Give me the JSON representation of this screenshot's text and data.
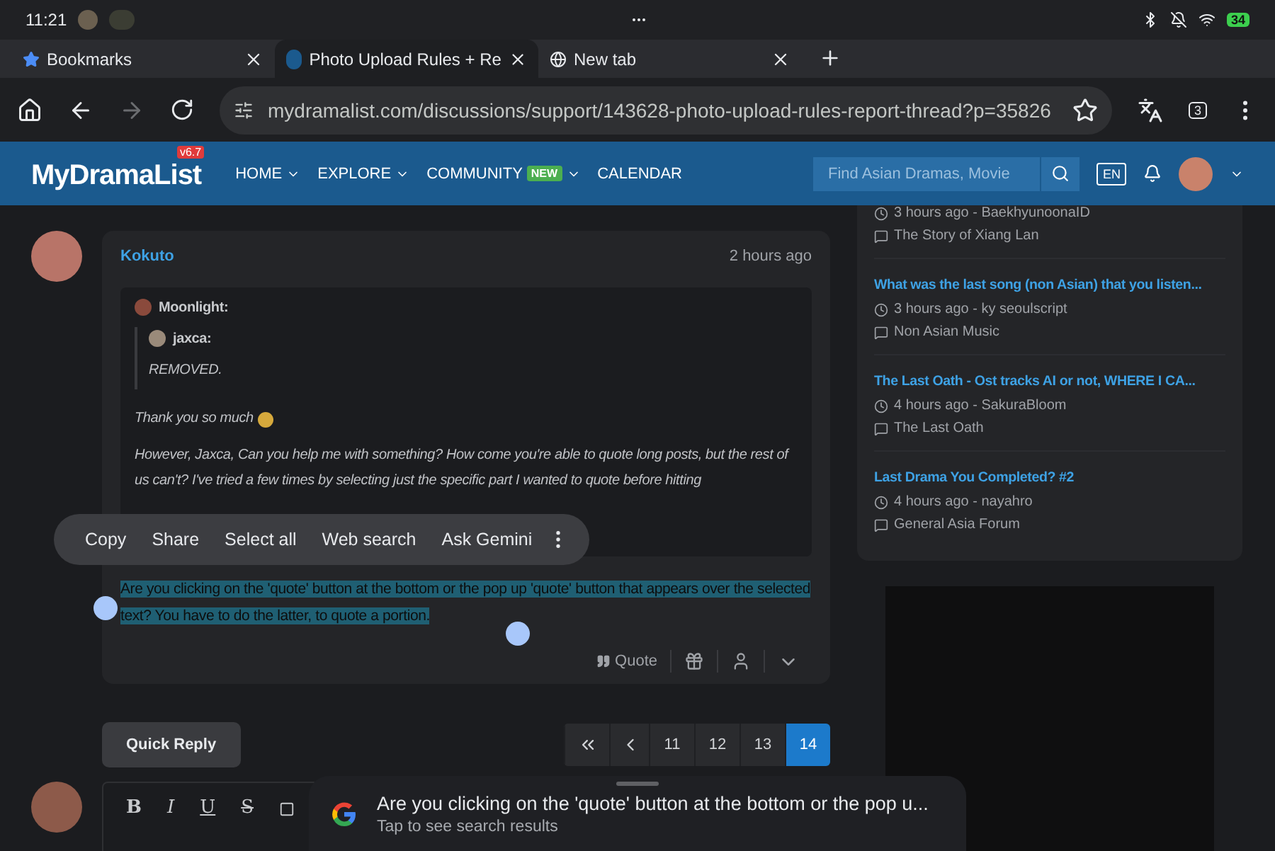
{
  "status_bar": {
    "time": "11:21",
    "battery": "34"
  },
  "browser_tabs": [
    {
      "title": "Bookmarks",
      "kind": "bookmarks",
      "selected": false
    },
    {
      "title": "Photo Upload Rules + Re",
      "kind": "site",
      "selected": true
    },
    {
      "title": "New tab",
      "kind": "newtab",
      "selected": false
    }
  ],
  "address_bar": {
    "url": "mydramalist.com/discussions/support/143628-photo-upload-rules-report-thread?p=35826",
    "tab_count": "3"
  },
  "site_header": {
    "logo": "MyDramaList",
    "version": "v6.7",
    "nav": [
      {
        "label": "HOME",
        "dropdown": true
      },
      {
        "label": "EXPLORE",
        "dropdown": true
      },
      {
        "label": "COMMUNITY",
        "badge": "NEW",
        "dropdown": true
      },
      {
        "label": "CALENDAR",
        "dropdown": false
      }
    ],
    "search": {
      "placeholder": "Find Asian Dramas, Movie"
    },
    "language": "EN"
  },
  "post": {
    "author": "Kokuto",
    "time": "2 hours ago",
    "quote": {
      "author": "Moonlight:",
      "nested": {
        "author": "jaxca:",
        "text": "REMOVED."
      },
      "paragraphs": [
        "Thank you so much",
        "However, Jaxca, Can you help me with something? How come you're able to quote long posts, but the rest of us can't? I've tried a few times by selecting just the specific part I wanted to quote before hitting"
      ]
    },
    "body": "Are you clicking on the 'quote' button at the bottom or the pop up 'quote' button that appears over the selected text? You have to do the latter, to quote a portion.",
    "body_selected": true,
    "actions": {
      "quote": "Quote"
    }
  },
  "selection_menu": [
    "Copy",
    "Share",
    "Select all",
    "Web search",
    "Ask Gemini"
  ],
  "sidebar": {
    "threads": [
      {
        "meta": "3 hours ago - BaekhyunoonaID",
        "forum": "The Story of Xiang Lan"
      },
      {
        "title": "What was the last song (non Asian) that you listen...",
        "meta": "3 hours ago - ky seoulscript",
        "forum": "Non Asian Music"
      },
      {
        "title": "The Last Oath - Ost tracks AI or not, WHERE I CA...",
        "meta": "4 hours ago - SakuraBloom",
        "forum": "The Last Oath"
      },
      {
        "title": "Last Drama You Completed? #2",
        "meta": "4 hours ago - nayahro",
        "forum": "General Asia Forum"
      }
    ]
  },
  "quick_reply": "Quick Reply",
  "pagination": [
    {
      "label": "11",
      "selected": false
    },
    {
      "label": "12",
      "selected": false
    },
    {
      "label": "13",
      "selected": false
    },
    {
      "label": "14",
      "selected": true
    }
  ],
  "editor_tools": [
    {
      "label": "B",
      "kind": "bold"
    },
    {
      "label": "I",
      "kind": "italic"
    },
    {
      "label": "U",
      "kind": "underline"
    },
    {
      "label": "S",
      "kind": "strike"
    }
  ],
  "search_sheet": {
    "query": "Are you clicking on the 'quote' button at the bottom or the pop u...",
    "hint": "Tap to see search results"
  }
}
